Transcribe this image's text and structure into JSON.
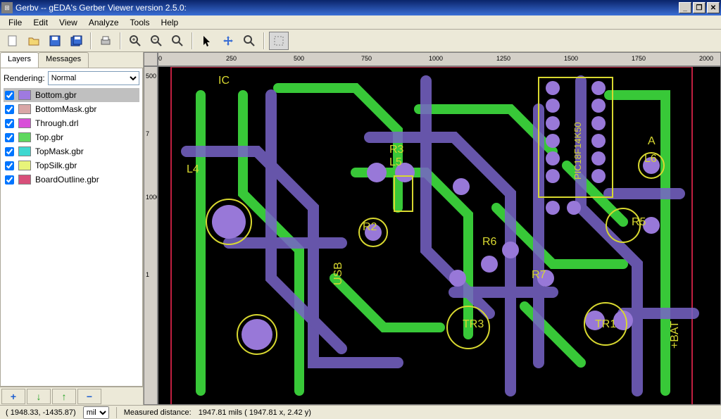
{
  "window": {
    "title": "Gerbv -- gEDA's Gerber Viewer version 2.5.0:"
  },
  "menu": {
    "file": "File",
    "edit": "Edit",
    "view": "View",
    "analyze": "Analyze",
    "tools": "Tools",
    "help": "Help"
  },
  "tabs": {
    "layers": "Layers",
    "messages": "Messages"
  },
  "rendering": {
    "label": "Rendering:",
    "value": "Normal"
  },
  "layers": [
    {
      "name": "Bottom.gbr",
      "color": "#9f7ae0",
      "checked": true,
      "selected": true
    },
    {
      "name": "BottomMask.gbr",
      "color": "#d9a6a6",
      "checked": true,
      "selected": false
    },
    {
      "name": "Through.drl",
      "color": "#d84fd8",
      "checked": true,
      "selected": false
    },
    {
      "name": "Top.gbr",
      "color": "#5fd85f",
      "checked": true,
      "selected": false
    },
    {
      "name": "TopMask.gbr",
      "color": "#3fd8d0",
      "checked": true,
      "selected": false
    },
    {
      "name": "TopSilk.gbr",
      "color": "#e8f47a",
      "checked": true,
      "selected": false
    },
    {
      "name": "BoardOutline.gbr",
      "color": "#d84f7a",
      "checked": true,
      "selected": false
    }
  ],
  "ruler": {
    "h_ticks": [
      "0",
      "250",
      "500",
      "750",
      "1000",
      "1250",
      "1500",
      "1750",
      "2000"
    ],
    "v_ticks": [
      "500",
      "7",
      "1000",
      "1"
    ]
  },
  "status": {
    "coords": "( 1948.33, -1435.87)",
    "unit": "mil",
    "measured_label": "Measured distance:",
    "measured_value": "1947.81 mils  ( 1947.81 x,      2.42 y)"
  },
  "icons": {
    "add": "+",
    "down": "↓",
    "up": "↑",
    "remove": "−"
  },
  "silk_labels": {
    "L4": "L4",
    "L5": "L5",
    "L6": "L6",
    "A": "A",
    "R2": "R2",
    "R3": "R3",
    "R5": "R5",
    "R6": "R6",
    "R7": "R7",
    "TR1": "TR1",
    "TR3": "TR3",
    "USB": "USB",
    "PIC": "PIC18F14K50",
    "BAT": "+BAT",
    "IC": "IC"
  }
}
